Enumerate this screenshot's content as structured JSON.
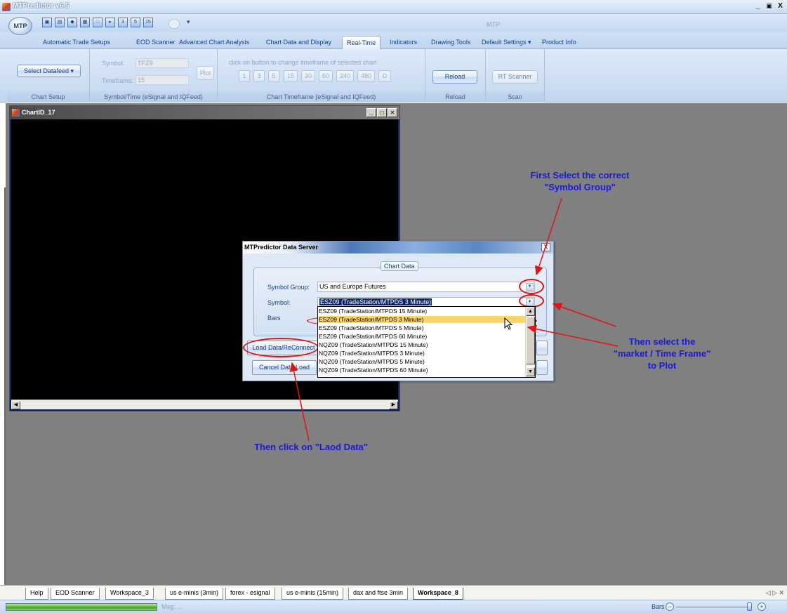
{
  "app": {
    "title": "MTPredictor v6.5",
    "workspace_title": "MTP:",
    "orb_label": "MTP",
    "quick_access": [
      "save",
      "open",
      "new",
      "layout",
      "window",
      "export",
      "3",
      "5",
      "15"
    ]
  },
  "window_controls": {
    "minimize": "_",
    "restore": "Ф",
    "close": "X"
  },
  "ribbon_tabs": [
    {
      "label": "Automatic Trade Setups"
    },
    {
      "label": "EOD Scanner"
    },
    {
      "label": "Advanced Chart Analysis"
    },
    {
      "label": "Chart Data and Display"
    },
    {
      "label": "Real-Time",
      "active": true
    },
    {
      "label": "Indicators"
    },
    {
      "label": "Drawing Tools"
    },
    {
      "label": "Default Settings ▾"
    },
    {
      "label": "Product Info"
    }
  ],
  "ribbon": {
    "chart_setup": {
      "button": "Select Datafeed ▾",
      "group_label": "Chart Setup"
    },
    "symbol_time": {
      "symbol_label": "Symbol:",
      "symbol_value": "TFZ9",
      "timeframe_label": "Timeframe:",
      "timeframe_value": "15",
      "plot_button": "Plot",
      "group_label": "Symbol/Time (eSignal and IQFeed)"
    },
    "timeframe": {
      "hint": "click on button to change timeframe of selected chart",
      "buttons": [
        "1",
        "3",
        "5",
        "15",
        "30",
        "60",
        "240",
        "480",
        "D"
      ],
      "group_label": "Chart Timeframe (eSignal and IQFeed)"
    },
    "reload": {
      "button": "Reload",
      "group_label": "Reload"
    },
    "scan": {
      "button": "RT Scanner",
      "group_label": "Scan"
    }
  },
  "chart_window": {
    "title": "ChartID_17",
    "scroll_left": "◀",
    "scroll_right": "▶"
  },
  "dialog": {
    "title": "MTPredictor Data Server",
    "close": "X",
    "panel_legend": "Chart Data",
    "symbol_group_label": "Symbol Group:",
    "symbol_group_value": "US and Europe Futures",
    "symbol_label": "Symbol:",
    "symbol_value": "ESZ09  (TradeStation/MTPDS 3 Minute)",
    "bars_label": "Bars",
    "load_button": "Load Data/ReConnect",
    "cancel_button": "Cancel Data Load"
  },
  "dropdown_items": [
    "ESZ09  (TradeStation/MTPDS 15 Minute)",
    "ESZ09  (TradeStation/MTPDS 3 Minute)",
    "ESZ09  (TradeStation/MTPDS 5 Minute)",
    "ESZ09  (TradeStation/MTPDS 60 Minute)",
    "NQZ09  (TradeStation/MTPDS 15 Minute)",
    "NQZ09  (TradeStation/MTPDS 3 Minute)",
    "NQZ09  (TradeStation/MTPDS 5 Minute)",
    "NQZ09  (TradeStation/MTPDS 60 Minute)"
  ],
  "dropdown_highlighted_index": 1,
  "annotations": {
    "first_line1": "First Select the correct",
    "first_line2": "\"Symbol Group\"",
    "then1_line1": "Then select the",
    "then1_line2": "\"market / Time Frame\"",
    "then1_line3": "to Plot",
    "then2": "Then click on \"Laod Data\""
  },
  "annotation_color": "#1a1ad6",
  "ring_color": "#e01515",
  "bottom_tabs": [
    {
      "label": "Help"
    },
    {
      "label": "EOD Scanner"
    },
    {
      "label": "Workspace_3"
    },
    {
      "label": "us e-minis (3min)"
    },
    {
      "label": "forex - esignal"
    },
    {
      "label": "us e-minis (15min)"
    },
    {
      "label": "dax and ftse 3min"
    },
    {
      "label": "Workspace_8",
      "active": true
    }
  ],
  "bottom_nav": "◁ ▷ ✕",
  "statusbar": {
    "progress": 1.0,
    "msg": "Msg: ...",
    "bars_label": "Bars",
    "zoom_minus": "−",
    "zoom_plus": "+"
  }
}
